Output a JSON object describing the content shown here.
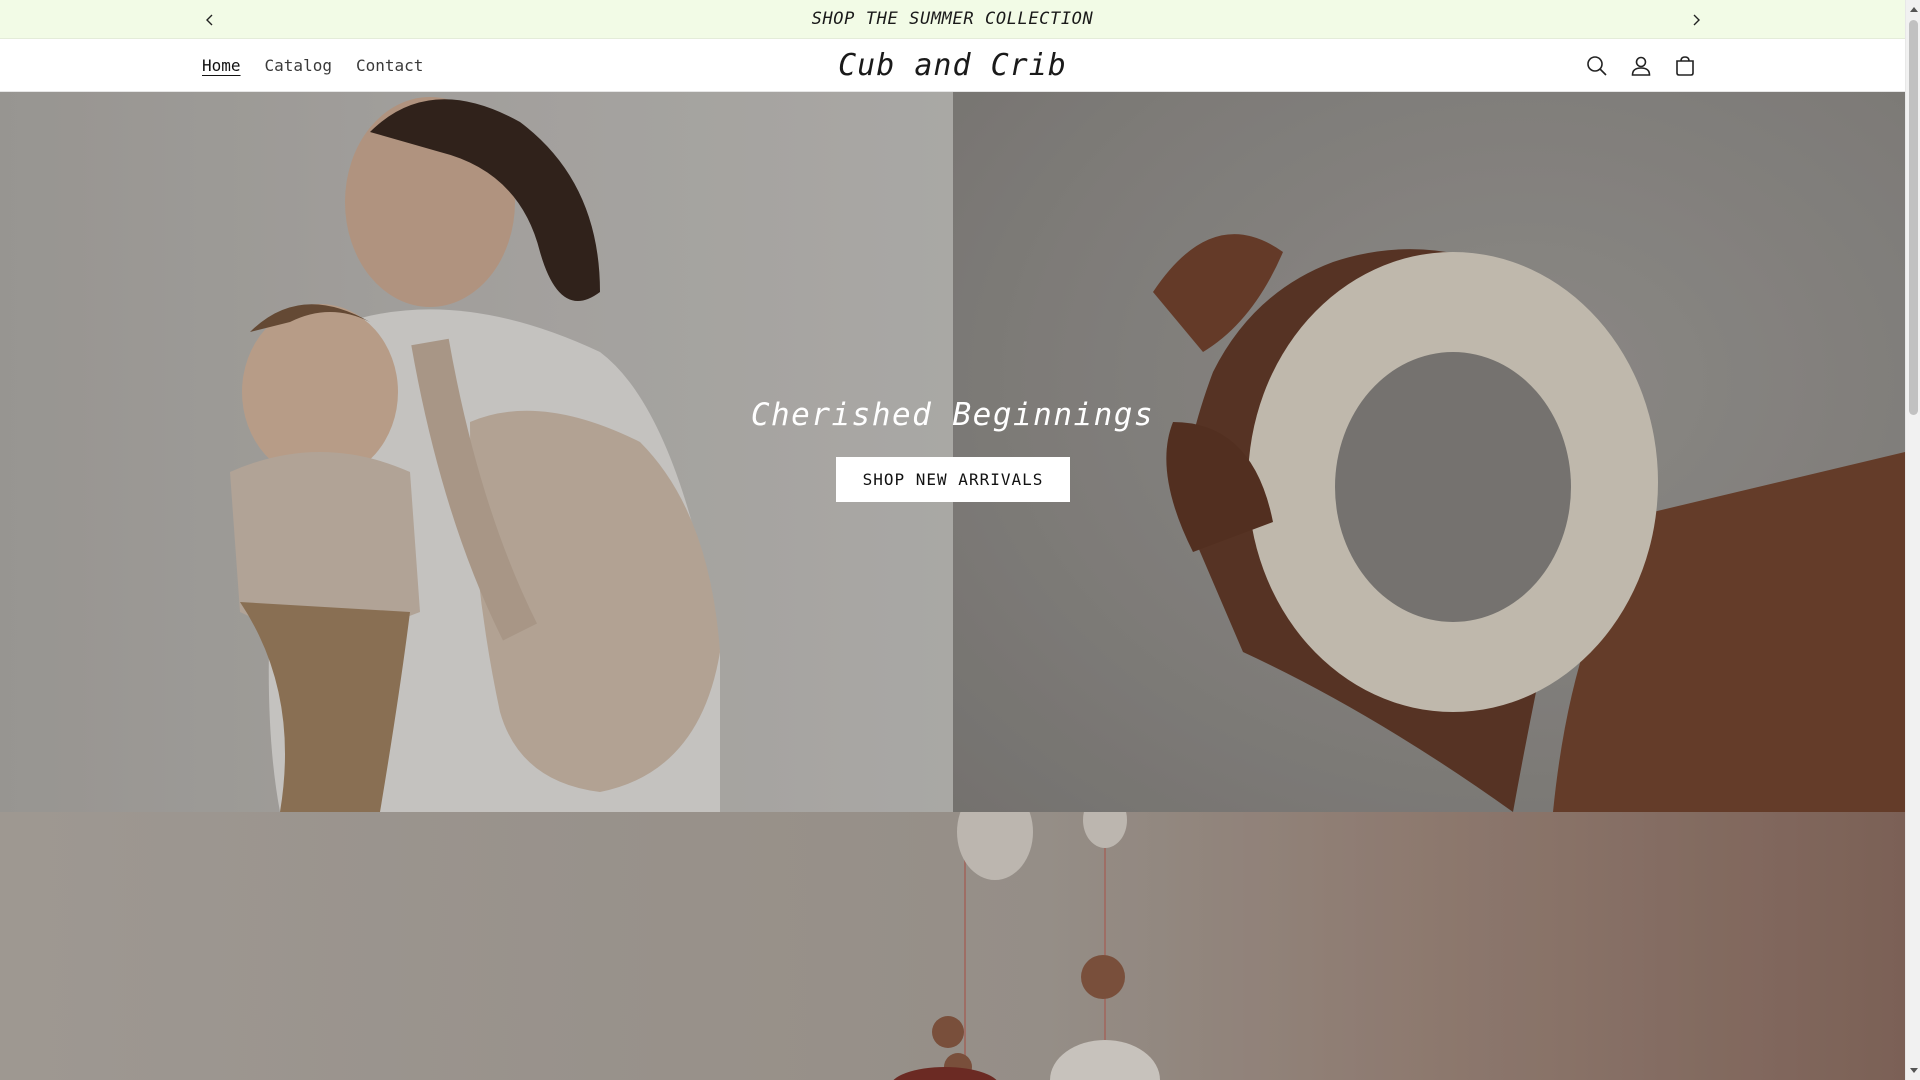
{
  "announcement": {
    "text": "SHOP THE SUMMER COLLECTION",
    "prev_icon": "chevron-left-icon",
    "next_icon": "chevron-right-icon",
    "background": "#f2fbe6"
  },
  "header": {
    "nav": [
      {
        "label": "Home",
        "active": true
      },
      {
        "label": "Catalog",
        "active": false
      },
      {
        "label": "Contact",
        "active": false
      }
    ],
    "logo": "Cub and Crib",
    "icons": [
      "search-icon",
      "account-icon",
      "cart-icon"
    ]
  },
  "hero": {
    "title": "Cherished Beginnings",
    "button_label": "SHOP NEW ARRIVALS",
    "left_image": "mother-and-baby-photo",
    "right_image": "baby-hand-teething-ring-photo"
  },
  "banner2": {
    "image": "nursery-mobile-photo"
  }
}
